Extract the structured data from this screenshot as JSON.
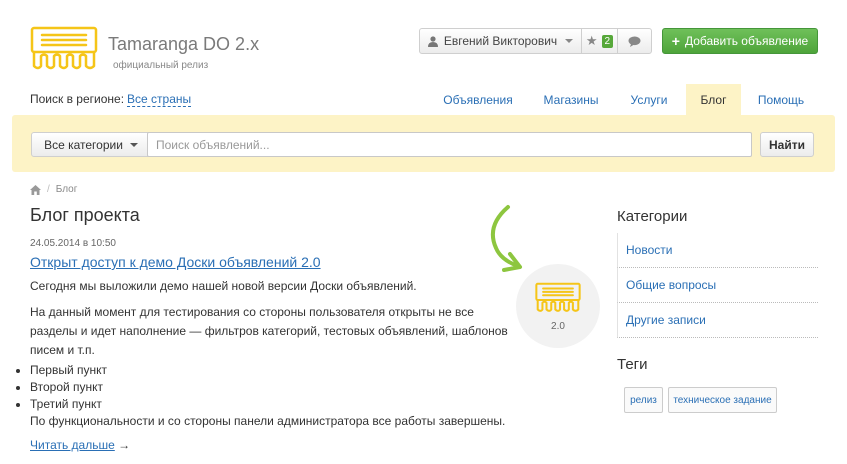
{
  "brand": {
    "title": "Tamaranga DO 2.x",
    "subtitle": "официальный релиз",
    "color": "#f5c518"
  },
  "header": {
    "user_name": "Евгений Викторович",
    "favorites_count": "2",
    "add_button_label": "Добавить объявление",
    "add_button_color": "#5ab244"
  },
  "region": {
    "label": "Поиск в регионе:",
    "value": "Все страны"
  },
  "nav": {
    "items": [
      {
        "label": "Объявления",
        "active": false
      },
      {
        "label": "Магазины",
        "active": false
      },
      {
        "label": "Услуги",
        "active": false
      },
      {
        "label": "Блог",
        "active": true
      },
      {
        "label": "Помощь",
        "active": false
      }
    ]
  },
  "search": {
    "category_label": "Все категории",
    "placeholder": "Поиск объявлений...",
    "value": "",
    "button_label": "Найти",
    "bar_color": "#fdf3c6"
  },
  "breadcrumb": {
    "current": "Блог"
  },
  "main": {
    "title": "Блог проекта",
    "post": {
      "date": "24.05.2014 в 10:50",
      "title": "Открыт доступ к демо Доски объявлений 2.0",
      "paragraph1": "Сегодня мы выложили демо нашей новой версии Доски объявлений.",
      "paragraph2": "На данный момент для тестирования со стороны пользователя открыты не все разделы и идет наполнение — фильтров категорий, тестовых объявлений, шаблонов писем и т.п.",
      "bullets": [
        "Первый пункт",
        "Второй пункт",
        "Третий пункт"
      ],
      "paragraph3": "По функциональности и со стороны панели администратора все работы завершены.",
      "read_more": "Читать дальше",
      "read_more_arrow": "→",
      "version_label": "2.0"
    }
  },
  "sidebar": {
    "categories_title": "Категории",
    "categories": [
      "Новости",
      "Общие вопросы",
      "Другие записи"
    ],
    "tags_title": "Теги",
    "tags": [
      "релиз",
      "техническое задание"
    ]
  }
}
